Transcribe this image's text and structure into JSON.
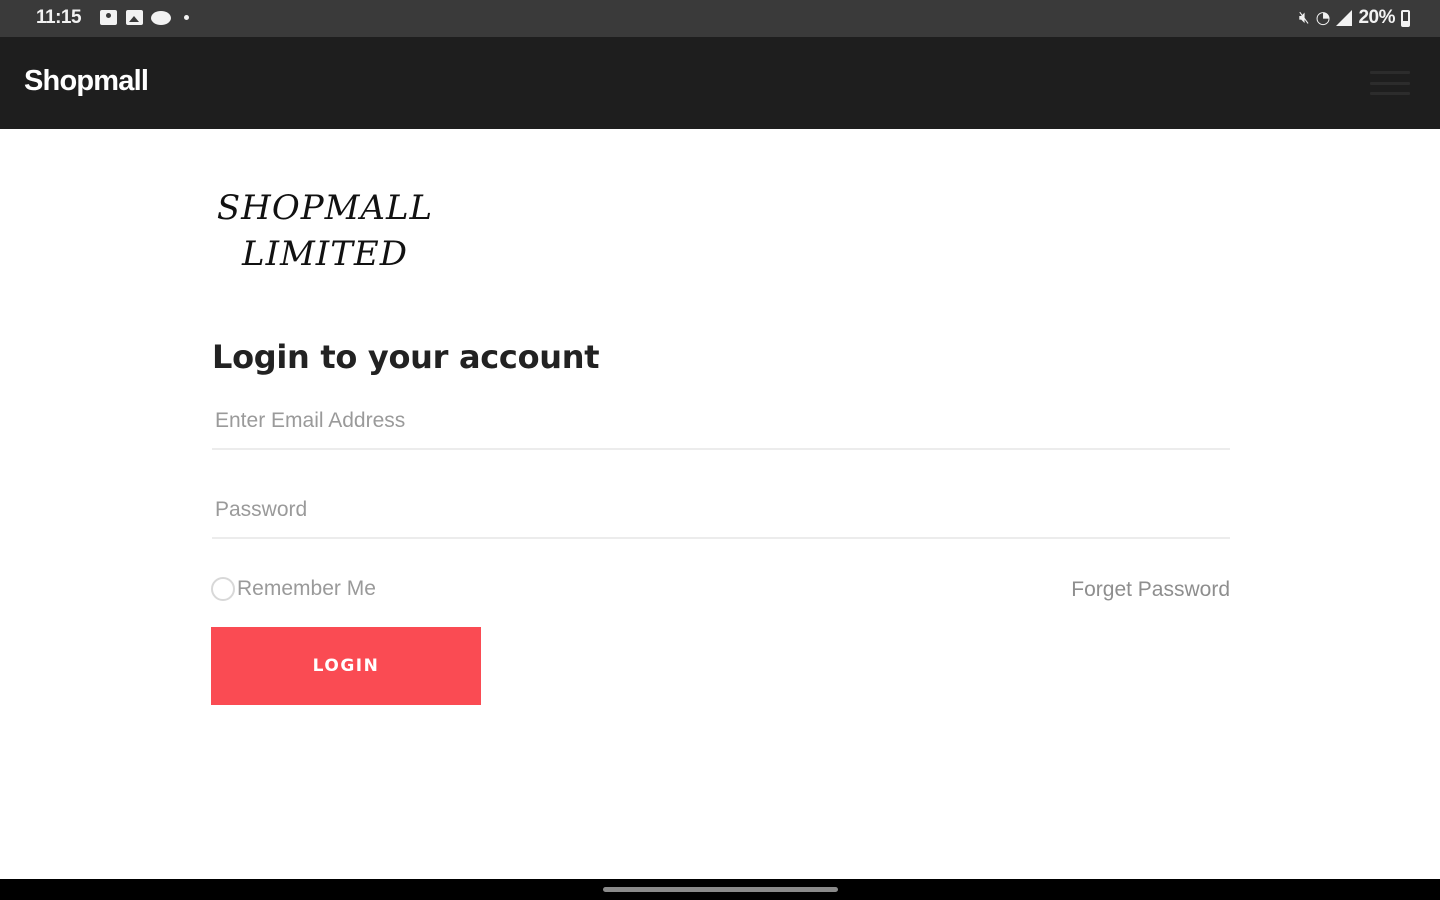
{
  "status_bar": {
    "time": "11:15",
    "icons": [
      "contact-card-icon",
      "image-icon",
      "chat-icon",
      "dot-icon"
    ],
    "right_icons": [
      "mute-icon",
      "wifi-icon",
      "signal-icon"
    ],
    "battery": "20%"
  },
  "app_bar": {
    "title": "Shopmall",
    "menu_icon": "hamburger-menu-icon"
  },
  "logo": {
    "line1": "SHOPMALL",
    "line2": "LIMITED"
  },
  "login_form": {
    "heading": "Login to your account",
    "email_placeholder": "Enter Email Address",
    "email_value": "",
    "password_placeholder": "Password",
    "password_value": "",
    "remember_label": "Remember Me",
    "remember_checked": false,
    "forgot_label": "Forget Password",
    "login_label": "LOGIN"
  },
  "colors": {
    "accent": "#fa4b53",
    "app_bar_bg": "#1e1e1e",
    "status_bar_bg": "#3a3a3a"
  }
}
